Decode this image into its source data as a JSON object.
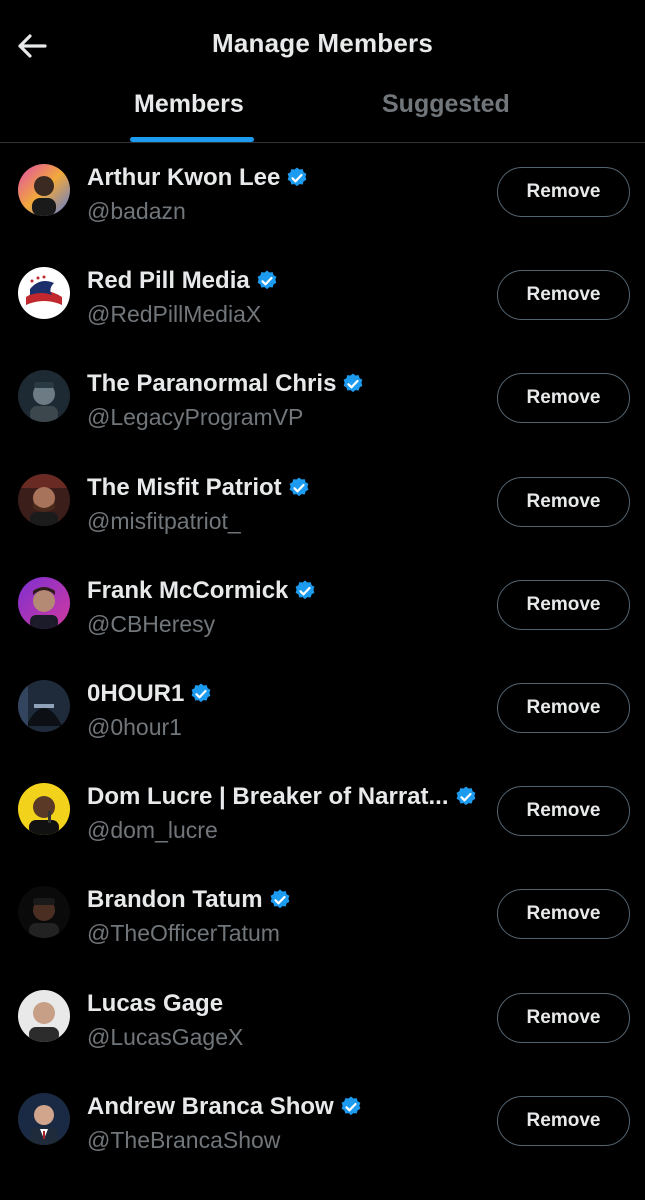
{
  "header": {
    "title": "Manage Members",
    "back_icon": "arrow-left-icon"
  },
  "tabs": [
    {
      "label": "Members",
      "active": true
    },
    {
      "label": "Suggested",
      "active": false
    }
  ],
  "colors": {
    "accent": "#1d9bf0",
    "background": "#000000",
    "secondary_text": "#71767b",
    "button_border": "#536471"
  },
  "members": [
    {
      "name": "Arthur Kwon Lee",
      "handle": "@badazn",
      "verified": true,
      "action": "Remove"
    },
    {
      "name": "Red Pill Media",
      "handle": "@RedPillMediaX",
      "verified": true,
      "action": "Remove"
    },
    {
      "name": "The Paranormal Chris",
      "handle": "@LegacyProgramVP",
      "verified": true,
      "action": "Remove"
    },
    {
      "name": "The Misfit Patriot",
      "handle": "@misfitpatriot_",
      "verified": true,
      "action": "Remove"
    },
    {
      "name": "Frank McCormick",
      "handle": "@CBHeresy",
      "verified": true,
      "action": "Remove"
    },
    {
      "name": "0HOUR1",
      "handle": "@0hour1",
      "verified": true,
      "action": "Remove"
    },
    {
      "name": "Dom Lucre | Breaker of Narrat...",
      "handle": "@dom_lucre",
      "verified": true,
      "action": "Remove"
    },
    {
      "name": "Brandon Tatum",
      "handle": "@TheOfficerTatum",
      "verified": true,
      "action": "Remove"
    },
    {
      "name": "Lucas Gage",
      "handle": "@LucasGageX",
      "verified": false,
      "action": "Remove"
    },
    {
      "name": "Andrew Branca Show",
      "handle": "@TheBrancaShow",
      "verified": true,
      "action": "Remove"
    }
  ]
}
